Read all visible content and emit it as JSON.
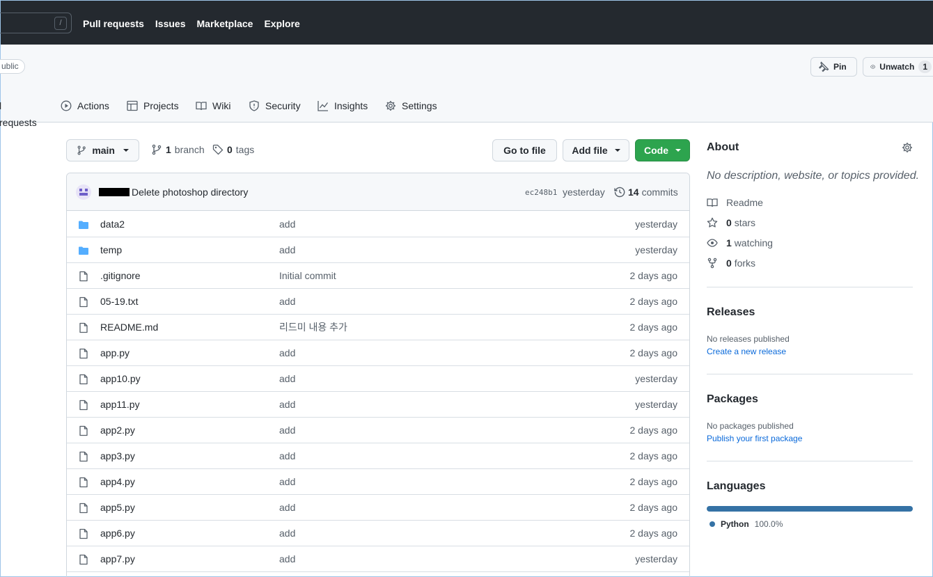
{
  "topbar": {
    "search_shortcut": "/",
    "nav": [
      "Pull requests",
      "Issues",
      "Marketplace",
      "Explore"
    ]
  },
  "repo": {
    "visibility": "Public",
    "visibility_shown": "ublic",
    "pin_label": "Pin",
    "unwatch_label": "Unwatch",
    "watch_count": "1",
    "tabs": [
      {
        "label": "l requests",
        "icon": "pull-request-icon"
      },
      {
        "label": "Actions",
        "icon": "play-icon"
      },
      {
        "label": "Projects",
        "icon": "table-icon"
      },
      {
        "label": "Wiki",
        "icon": "book-icon"
      },
      {
        "label": "Security",
        "icon": "shield-icon"
      },
      {
        "label": "Insights",
        "icon": "graph-icon"
      },
      {
        "label": "Settings",
        "icon": "gear-icon"
      }
    ]
  },
  "toolbar": {
    "branch": "main",
    "branch_count": "1",
    "branch_label": "branch",
    "tag_count": "0",
    "tag_label": "tags",
    "go_to_file": "Go to file",
    "add_file": "Add file",
    "code": "Code"
  },
  "commit": {
    "message": "Delete photoshop directory",
    "sha": "ec248b1",
    "when": "yesterday",
    "count": "14",
    "count_label": "commits"
  },
  "files": [
    {
      "type": "dir",
      "name": "data2",
      "message": "add",
      "date": "yesterday"
    },
    {
      "type": "dir",
      "name": "temp",
      "message": "add",
      "date": "yesterday"
    },
    {
      "type": "file",
      "name": ".gitignore",
      "message": "Initial commit",
      "date": "2 days ago"
    },
    {
      "type": "file",
      "name": "05-19.txt",
      "message": "add",
      "date": "2 days ago"
    },
    {
      "type": "file",
      "name": "README.md",
      "message": "리드미 내용 추가",
      "date": "2 days ago"
    },
    {
      "type": "file",
      "name": "app.py",
      "message": "add",
      "date": "2 days ago"
    },
    {
      "type": "file",
      "name": "app10.py",
      "message": "add",
      "date": "yesterday"
    },
    {
      "type": "file",
      "name": "app11.py",
      "message": "add",
      "date": "yesterday"
    },
    {
      "type": "file",
      "name": "app2.py",
      "message": "add",
      "date": "2 days ago"
    },
    {
      "type": "file",
      "name": "app3.py",
      "message": "add",
      "date": "2 days ago"
    },
    {
      "type": "file",
      "name": "app4.py",
      "message": "add",
      "date": "2 days ago"
    },
    {
      "type": "file",
      "name": "app5.py",
      "message": "add",
      "date": "2 days ago"
    },
    {
      "type": "file",
      "name": "app6.py",
      "message": "add",
      "date": "2 days ago"
    },
    {
      "type": "file",
      "name": "app7.py",
      "message": "add",
      "date": "yesterday"
    }
  ],
  "sidebar": {
    "about_title": "About",
    "about_desc": "No description, website, or topics provided.",
    "readme": "Readme",
    "stars_count": "0",
    "stars_label": "stars",
    "watching_count": "1",
    "watching_label": "watching",
    "forks_count": "0",
    "forks_label": "forks",
    "releases_title": "Releases",
    "releases_none": "No releases published",
    "releases_link": "Create a new release",
    "packages_title": "Packages",
    "packages_none": "No packages published",
    "packages_link": "Publish your first package",
    "languages_title": "Languages",
    "language_name": "Python",
    "language_pct": "100.0%",
    "language_color": "#3572A5"
  },
  "colors": {
    "header_bg": "#24292f",
    "code_button": "#2da44e",
    "link": "#0969da",
    "folder_icon": "#54aeff"
  }
}
